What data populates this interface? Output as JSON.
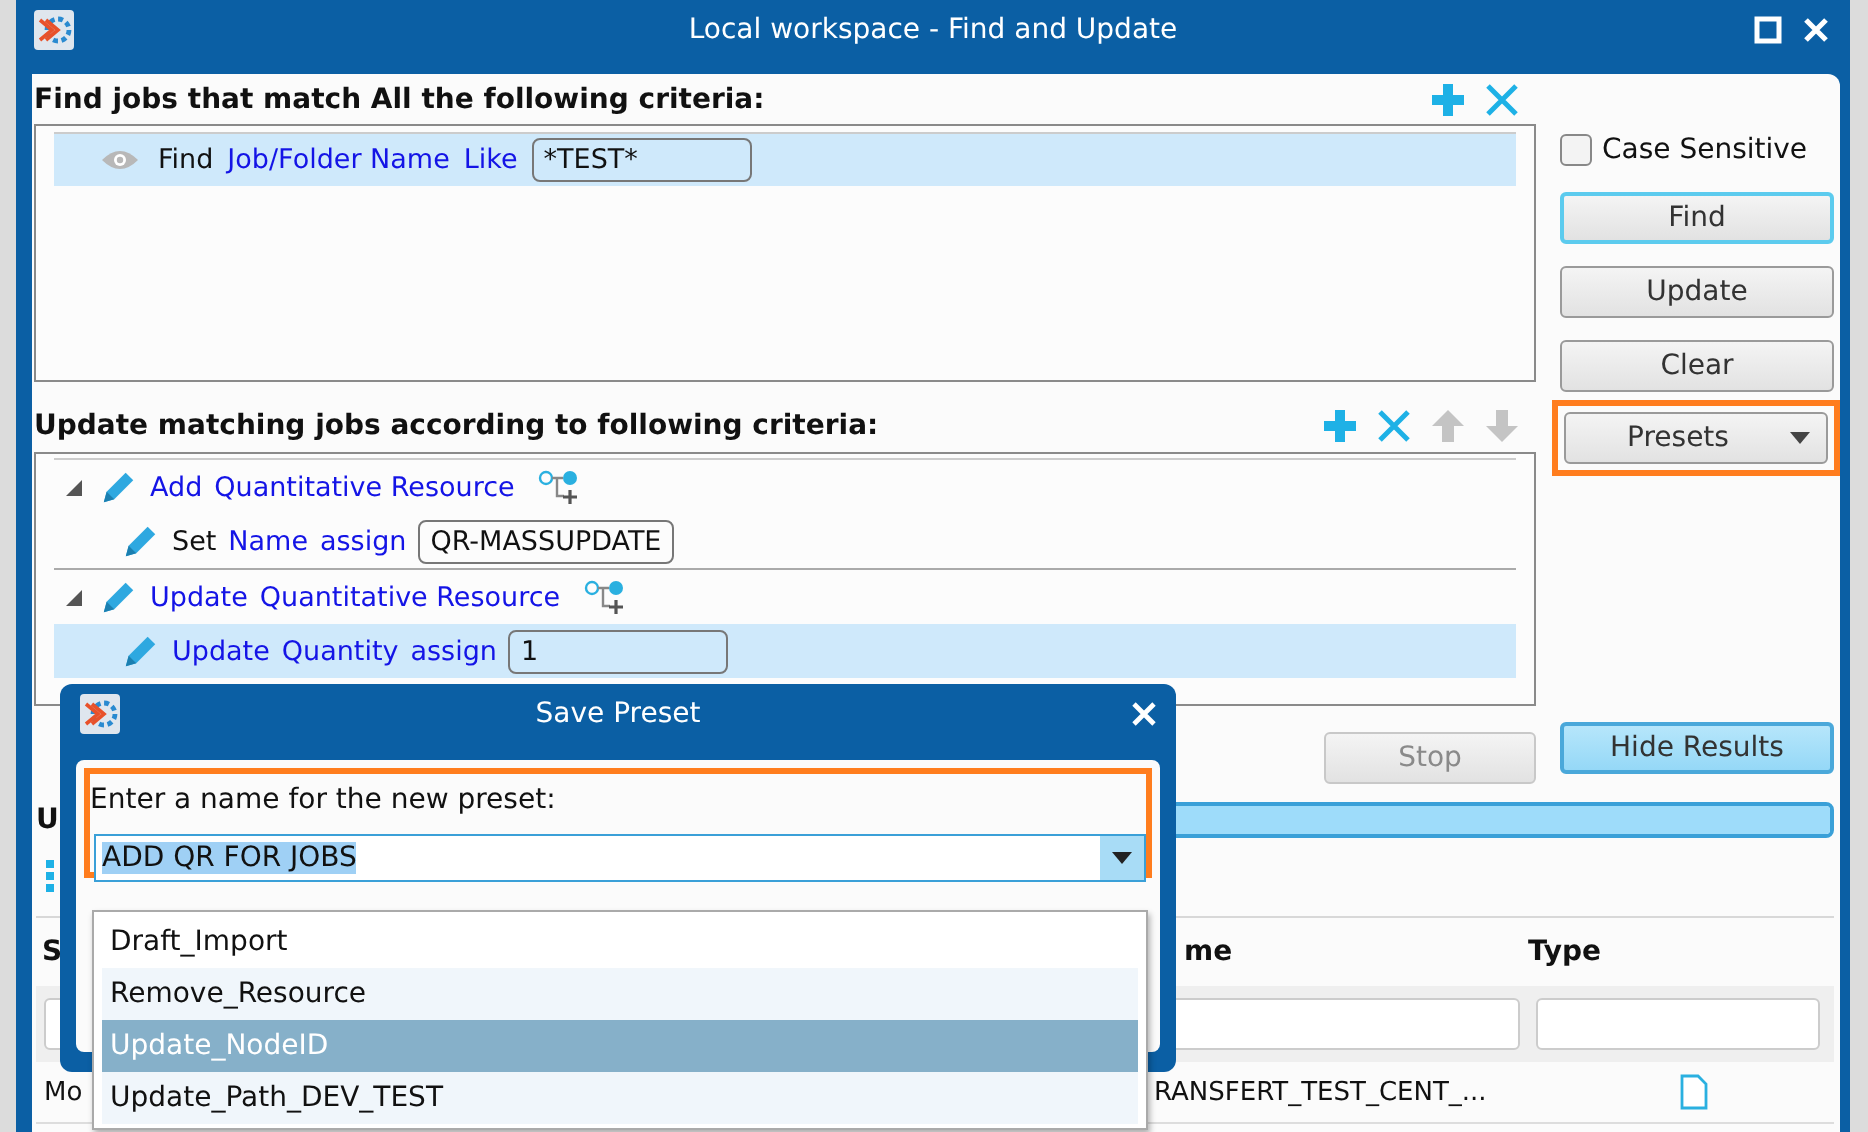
{
  "window": {
    "title": "Local workspace - Find and Update"
  },
  "find_section": {
    "title": "Find jobs that match All the following criteria:",
    "criteria": [
      {
        "verb": "Find",
        "verb_is_link": false,
        "field": "Job/Folder Name",
        "operator": "Like",
        "value": "*TEST*",
        "selected": true
      }
    ]
  },
  "case_sensitive": {
    "label": "Case Sensitive",
    "checked": false
  },
  "action_buttons": [
    {
      "label": "Find",
      "focused": true
    },
    {
      "label": "Update",
      "focused": false
    },
    {
      "label": "Clear",
      "focused": false
    }
  ],
  "presets_button": {
    "label": "Presets",
    "highlighted": true
  },
  "update_section": {
    "title": "Update matching jobs according to following criteria:",
    "rules": [
      {
        "verb": "Add",
        "target": "Quantitative Resource",
        "expanded": true,
        "selected": false,
        "children": [
          {
            "verb": "Set",
            "verb_is_link": false,
            "field": "Name",
            "operator": "assign",
            "value": "QR-MASSUPDATE",
            "selected": false
          }
        ]
      },
      {
        "verb": "Update",
        "target": "Quantitative Resource",
        "expanded": true,
        "selected": false,
        "children": [
          {
            "verb": "Update",
            "verb_is_link": true,
            "field": "Quantity",
            "operator": "assign",
            "value": "1",
            "selected": true
          }
        ]
      }
    ]
  },
  "stop_button": {
    "label": "Stop",
    "disabled": true
  },
  "hide_results_button": {
    "label": "Hide Results",
    "pressed": true
  },
  "results": {
    "title": "U",
    "progress": {
      "level": 1
    },
    "columns": [
      "S",
      "me",
      "Type"
    ],
    "rows": [
      {
        "cells": [
          "Mo",
          "RANSFERT_TEST_CENT_..."
        ]
      }
    ]
  },
  "dialog": {
    "title": "Save Preset",
    "prompt": "Enter a name for the new preset:",
    "highlighted": true,
    "value": "ADD QR FOR JOBS",
    "value_selected": true,
    "options": [
      {
        "label": "Draft_Import",
        "selected": false
      },
      {
        "label": "Remove_Resource",
        "selected": false
      },
      {
        "label": "Update_NodeID",
        "selected": true
      },
      {
        "label": "Update_Path_DEV_TEST",
        "selected": false
      }
    ]
  }
}
